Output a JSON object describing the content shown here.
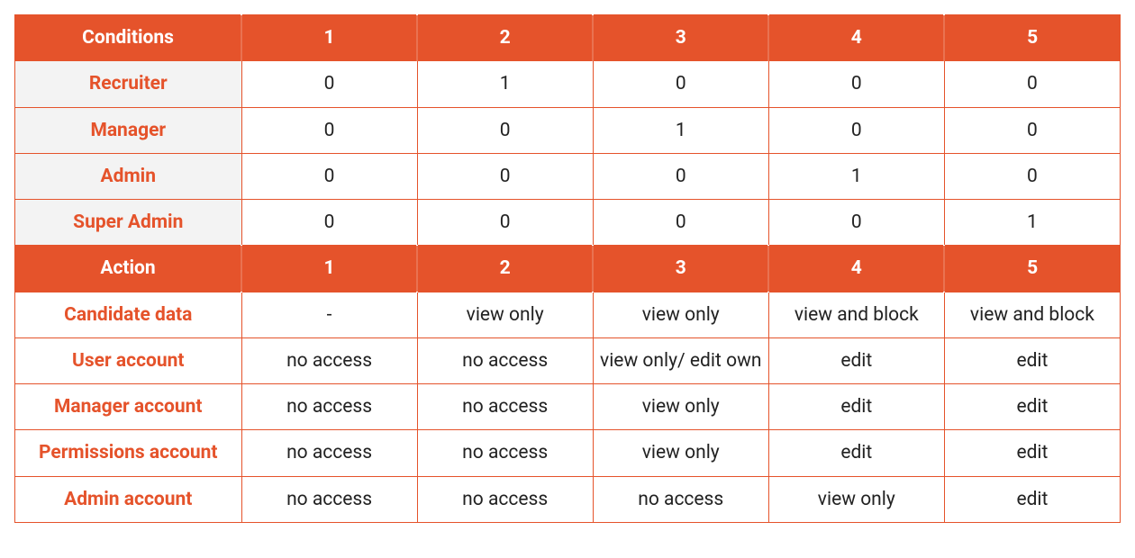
{
  "chart_data": {
    "type": "table",
    "sections": [
      {
        "header_label": "Conditions",
        "columns": [
          "1",
          "2",
          "3",
          "4",
          "5"
        ],
        "rows": [
          {
            "label": "Recruiter",
            "values": [
              "0",
              "1",
              "0",
              "0",
              "0"
            ]
          },
          {
            "label": "Manager",
            "values": [
              "0",
              "0",
              "1",
              "0",
              "0"
            ]
          },
          {
            "label": "Admin",
            "values": [
              "0",
              "0",
              "0",
              "1",
              "0"
            ]
          },
          {
            "label": "Super Admin",
            "values": [
              "0",
              "0",
              "0",
              "0",
              "1"
            ]
          }
        ]
      },
      {
        "header_label": "Action",
        "columns": [
          "1",
          "2",
          "3",
          "4",
          "5"
        ],
        "rows": [
          {
            "label": "Candidate data",
            "values": [
              "-",
              "view only",
              "view only",
              "view and block",
              "view and block"
            ]
          },
          {
            "label": "User account",
            "values": [
              "no access",
              "no access",
              "view only/ edit own",
              "edit",
              "edit"
            ]
          },
          {
            "label": "Manager account",
            "values": [
              "no access",
              "no access",
              "view only",
              "edit",
              "edit"
            ]
          },
          {
            "label": "Permissions account",
            "values": [
              "no access",
              "no access",
              "view only",
              "edit",
              "edit"
            ]
          },
          {
            "label": "Admin account",
            "values": [
              "no access",
              "no access",
              "no access",
              "view only",
              "edit"
            ]
          }
        ]
      }
    ]
  },
  "colors": {
    "accent": "#e5532b",
    "row_label_bg": "#f3f3f3"
  }
}
